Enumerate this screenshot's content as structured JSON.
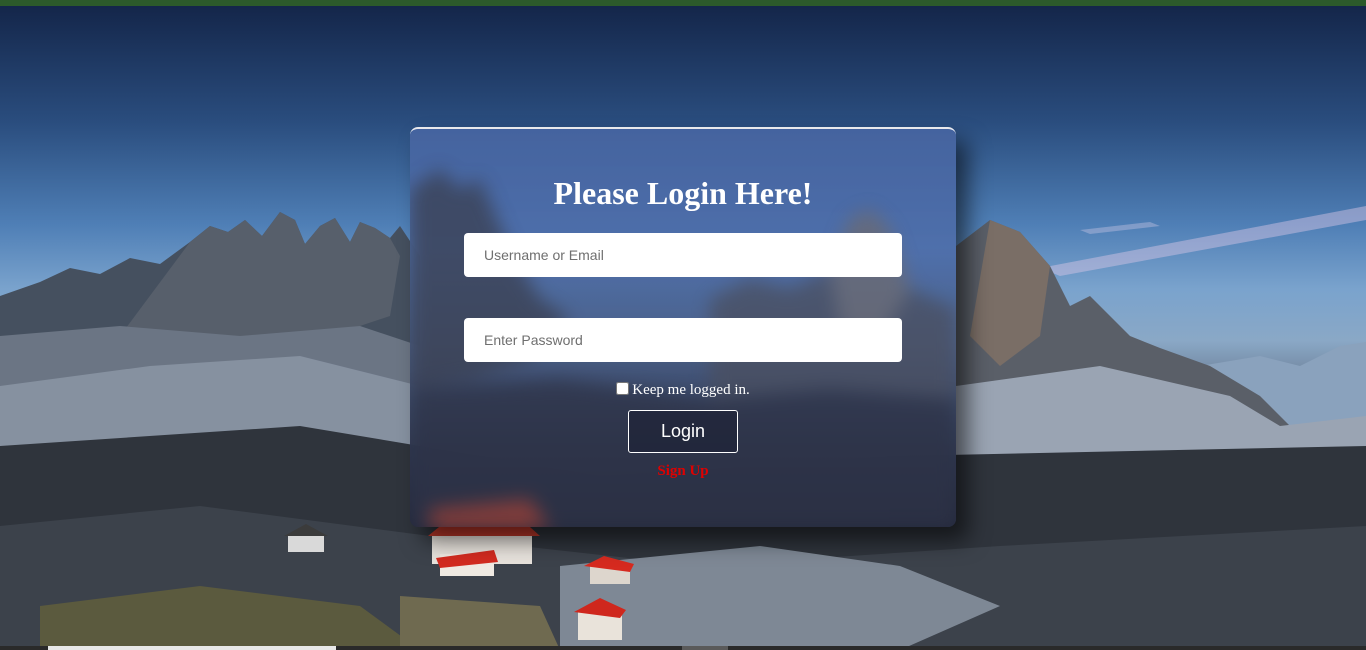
{
  "login": {
    "title": "Please Login Here!",
    "username_placeholder": "Username or Email",
    "password_placeholder": "Enter Password",
    "remember_label": "Keep me logged in.",
    "remember_checked": false,
    "login_button": "Login",
    "signup_link": "Sign Up"
  },
  "background": {
    "description_icon": "mountain-landscape-image"
  },
  "colors": {
    "top_bar": "#2c5a2b",
    "signup_link": "#e00000",
    "title_text": "#ffffff"
  }
}
